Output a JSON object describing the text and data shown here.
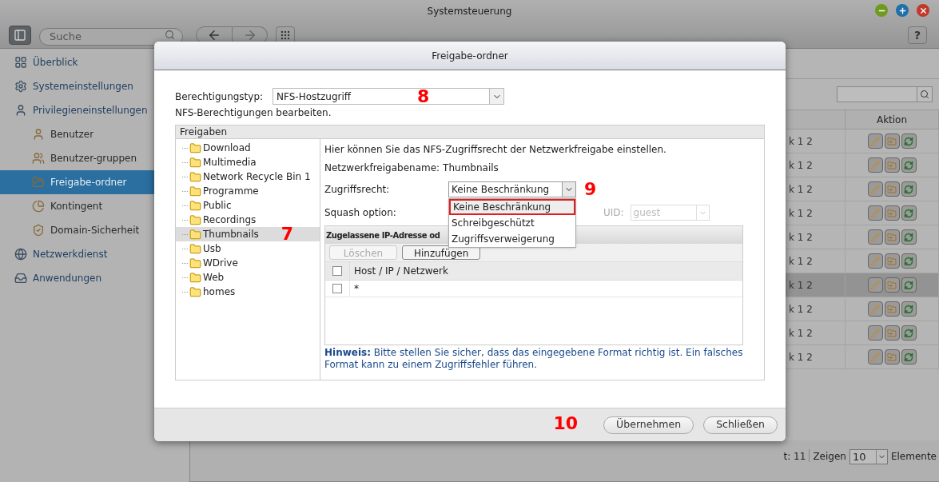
{
  "window": {
    "title": "Systemsteuerung"
  },
  "toolbar": {
    "search": {
      "placeholder": "Suche"
    },
    "help": "?"
  },
  "sidebar": {
    "items": [
      {
        "label": "Überblick",
        "selected": false
      },
      {
        "label": "Systemeinstellungen",
        "selected": false
      },
      {
        "label": "Privilegieneinstellungen",
        "selected": false,
        "children": [
          {
            "label": "Benutzer",
            "selected": false
          },
          {
            "label": "Benutzer-gruppen",
            "selected": false
          },
          {
            "label": "Freigabe-ordner",
            "selected": true
          },
          {
            "label": "Kontingent",
            "selected": false
          },
          {
            "label": "Domain-Sicherheit",
            "selected": false
          }
        ]
      },
      {
        "label": "Netzwerkdienst",
        "selected": false
      },
      {
        "label": "Anwendungen",
        "selected": false
      }
    ]
  },
  "table": {
    "columns": [
      "Aktion"
    ],
    "rows": [
      {
        "column_1": "k 1 2",
        "selected": false
      },
      {
        "column_1": "k 1 2",
        "selected": false
      },
      {
        "column_1": "k 1 2",
        "selected": false
      },
      {
        "column_1": "k 1 2",
        "selected": false
      },
      {
        "column_1": "k 1 2",
        "selected": false
      },
      {
        "column_1": "k 1 2",
        "selected": false
      },
      {
        "column_1": "k 1 2",
        "selected": true
      },
      {
        "column_1": "k 1 2",
        "selected": false
      },
      {
        "column_1": "k 1 2",
        "selected": false
      },
      {
        "column_1": "k 1 2",
        "selected": false
      }
    ]
  },
  "pager": {
    "total": "t: 11",
    "show_label": "Zeigen",
    "page_size": "10",
    "unit": "Elemente"
  },
  "dialog": {
    "title": "Freigabe-ordner",
    "permission_type": {
      "label": "Berechtigungstyp:",
      "value": "NFS-Hostzugriff",
      "callout": "8"
    },
    "subtitle": "NFS-Berechtigungen bearbeiten.",
    "shares": {
      "title": "Freigaben",
      "callout": "7",
      "folders": [
        {
          "name": "Download",
          "selected": false
        },
        {
          "name": "Multimedia",
          "selected": false
        },
        {
          "name": "Network Recycle Bin 1",
          "selected": false
        },
        {
          "name": "Programme",
          "selected": false
        },
        {
          "name": "Public",
          "selected": false
        },
        {
          "name": "Recordings",
          "selected": false
        },
        {
          "name": "Thumbnails",
          "selected": true
        },
        {
          "name": "Usb",
          "selected": false
        },
        {
          "name": "WDrive",
          "selected": false
        },
        {
          "name": "Web",
          "selected": false
        },
        {
          "name": "homes",
          "selected": false
        }
      ]
    },
    "intro": "Hier können Sie das NFS-Zugriffsrecht der Netzwerkfreigabe einstellen.",
    "share_name": {
      "label": "Netzwerkfreigabename:",
      "value": "Thumbnails"
    },
    "access": {
      "label": "Zugriffsrecht:",
      "value": "Keine Beschränkung",
      "callout": "9",
      "options": [
        {
          "label": "Keine Beschränkung",
          "selected": true
        },
        {
          "label": "Schreibgeschützt",
          "selected": false
        },
        {
          "label": "Zugriffsverweigerung",
          "selected": false
        }
      ]
    },
    "squash": {
      "label": "Squash option:"
    },
    "uid": {
      "label": "UID:",
      "value": "guest",
      "disabled": true
    },
    "ip_grid": {
      "title": "Zugelassene IP-Adresse od",
      "buttons": [
        {
          "label": "Löschen",
          "disabled": true
        },
        {
          "label": "Hinzufügen",
          "disabled": false
        }
      ],
      "header_checked": false,
      "columns": [
        "Host / IP / Netzwerk"
      ],
      "rows": [
        {
          "host": "*",
          "checked": false
        }
      ]
    },
    "note": "**Hinweis:** Bitte stellen Sie sicher, dass das eingegebene Format richtig ist. Ein falsches Format kann zu einem Zugriffsfehler führen.",
    "footer_callout": "10",
    "buttons": [
      "Übernehmen",
      "Schließen"
    ]
  }
}
